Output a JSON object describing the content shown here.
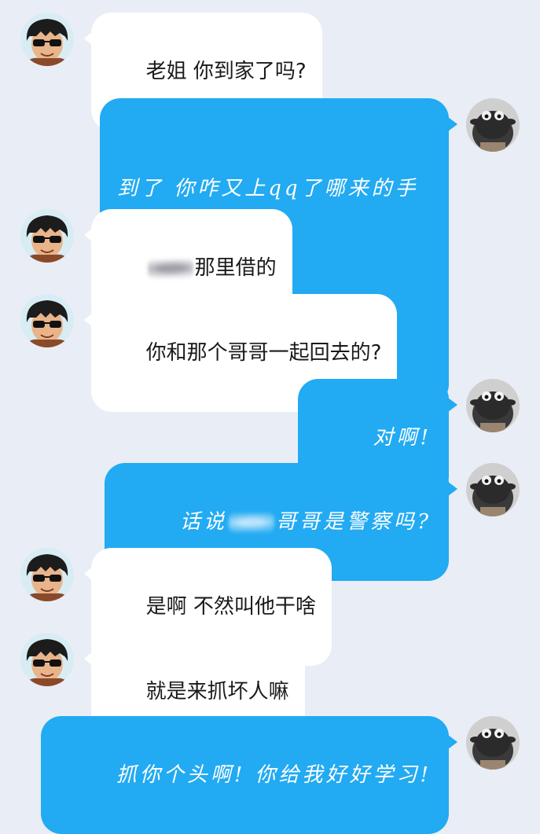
{
  "chat": {
    "messages": [
      {
        "side": "left",
        "text": "老姐 你到家了吗?"
      },
      {
        "side": "right",
        "line1": "到了 你咋又上qq了哪来的手机",
        "line2": "?"
      },
      {
        "side": "left",
        "text_after": "那里借的"
      },
      {
        "side": "left",
        "text": "你和那个哥哥一起回去的?"
      },
      {
        "side": "right",
        "text": "对啊!"
      },
      {
        "side": "right",
        "text_before": "话说",
        "text_after": "哥哥是警察吗?"
      },
      {
        "side": "left",
        "text": "是啊 不然叫他干啥"
      },
      {
        "side": "left",
        "text": "就是来抓坏人嘛"
      },
      {
        "side": "right",
        "text": "抓你个头啊! 你给我好好学习!"
      }
    ]
  },
  "avatars": {
    "left": "sunglasses-boy-avatar",
    "right": "plush-sheep-avatar"
  },
  "colors": {
    "background": "#e9edf5",
    "left_bubble": "#ffffff",
    "right_bubble": "#22aaf2"
  }
}
